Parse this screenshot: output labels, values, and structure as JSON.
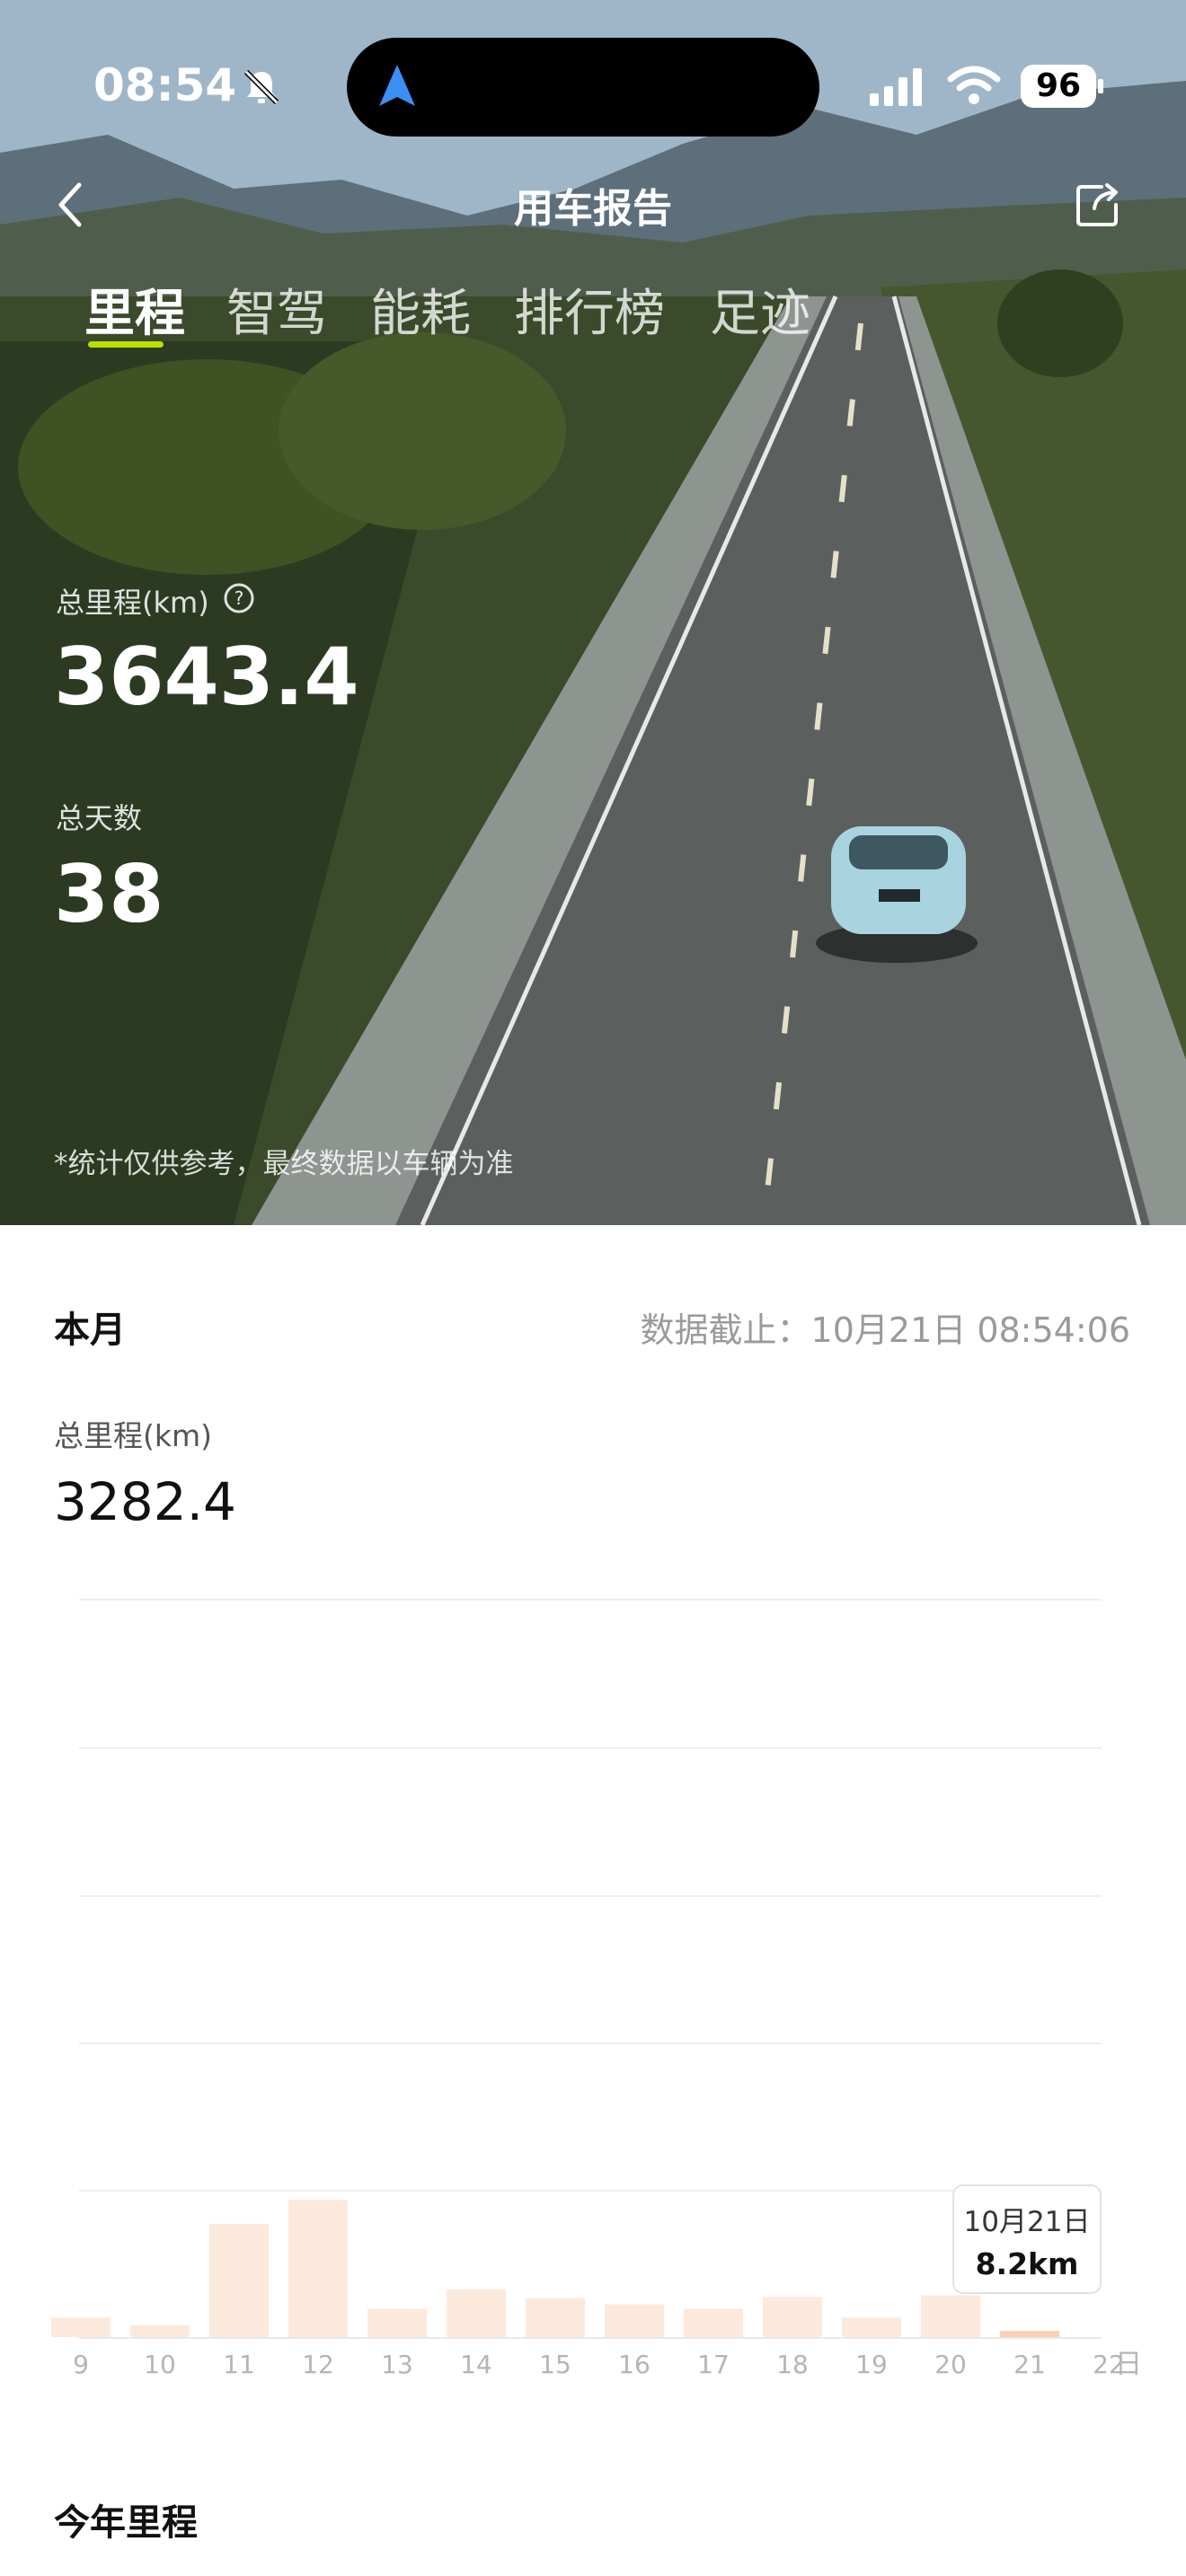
{
  "status_bar": {
    "time": "08:54",
    "battery": "96"
  },
  "header": {
    "title": "用车报告"
  },
  "tabs": [
    {
      "label": "里程",
      "active": true
    },
    {
      "label": "智驾"
    },
    {
      "label": "能耗"
    },
    {
      "label": "排行榜"
    },
    {
      "label": "足迹"
    }
  ],
  "summary": {
    "total_mileage_label": "总里程(km)",
    "total_mileage": "3643.4",
    "total_days_label": "总天数",
    "total_days": "38",
    "disclaimer": "*统计仅供参考，最终数据以车辆为准"
  },
  "month": {
    "title": "本月",
    "data_as_of": "数据截止：10月21日 08:54:06",
    "mileage_label": "总里程(km)",
    "mileage": "3282.4"
  },
  "tooltip": {
    "date": "10月21日",
    "value": "8.2km"
  },
  "chart_data": {
    "type": "bar",
    "categories": [
      "9",
      "10",
      "11",
      "12",
      "13",
      "14",
      "15",
      "16",
      "17",
      "18",
      "19",
      "20",
      "21",
      "22"
    ],
    "values": [
      26,
      16,
      152,
      184,
      38,
      64,
      52,
      44,
      38,
      54,
      26,
      56,
      8.2,
      0
    ],
    "x_unit": "日",
    "bar_color": "#fde9dc",
    "highlight_color": "#fbd0b4",
    "highlight_index": 12
  },
  "year": {
    "title": "今年里程"
  }
}
